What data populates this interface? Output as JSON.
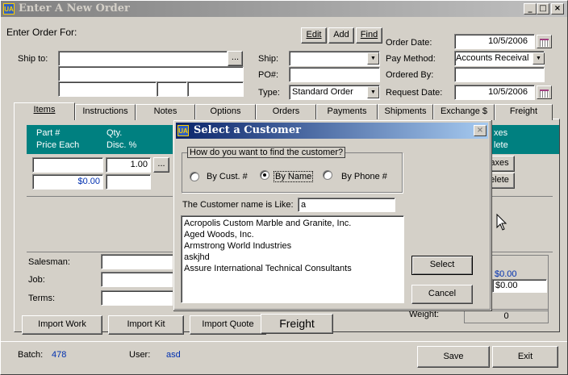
{
  "window": {
    "title": "Enter A New Order",
    "app_badge": "UA",
    "minimize": "_",
    "maximize": "□",
    "close": "×"
  },
  "header": {
    "enter_for": "Enter Order For:",
    "edit": "Edit",
    "add": "Add",
    "find": "Find",
    "ship_to": "Ship to:",
    "browse": "...",
    "ship": "Ship:",
    "po": "PO#:",
    "type": "Type:",
    "type_value": "Standard Order",
    "order_date": "Order Date:",
    "order_date_value": "10/5/2006",
    "pay_method": "Pay Method:",
    "pay_method_value": "Accounts Receival",
    "ordered_by": "Ordered By:",
    "request_date": "Request Date:",
    "request_date_value": "10/5/2006"
  },
  "tabs": [
    "Items",
    "Instructions",
    "Notes",
    "Options",
    "Orders",
    "Payments",
    "Shipments",
    "Exchange $",
    "Freight"
  ],
  "items": {
    "col_part": "Part #",
    "col_price": "Price Each",
    "col_qty": "Qty.",
    "col_disc": "Disc. %",
    "col_taxes_tail": "xes",
    "col_delete_tail": "lete",
    "qty_value": "1.00",
    "price_value": "$0.00",
    "browse": "...",
    "taxes_btn_tail": "axes",
    "delete_btn_tail": "elete"
  },
  "lower": {
    "salesman": "Salesman:",
    "job": "Job:",
    "terms": "Terms:",
    "total1": "$0.00",
    "total2": "$0.00",
    "weight": "Weight:",
    "weight_value": "0"
  },
  "bottom_buttons": {
    "import_work": "Import Work",
    "import_kit": "Import Kit",
    "import_quote": "Import Quote",
    "freight": "Freight"
  },
  "footer": {
    "batch_label": "Batch:",
    "batch_value": "478",
    "user_label": "User:",
    "user_value": "asd",
    "save": "Save",
    "exit": "Exit"
  },
  "dialog": {
    "title": "Select a Customer",
    "badge": "UA",
    "close": "×",
    "group_label": "How do you want to find the customer?",
    "by_cust": "By Cust. #",
    "by_name": "By Name",
    "by_phone": "By Phone #",
    "like_label": "The Customer name is Like:",
    "like_value": "a",
    "customers": [
      "Acropolis Custom Marble and Granite, Inc.",
      "Aged Woods, Inc.",
      "Armstrong World Industries",
      "askjhd",
      "Assure International Technical Consultants"
    ],
    "select": "Select",
    "cancel": "Cancel"
  }
}
